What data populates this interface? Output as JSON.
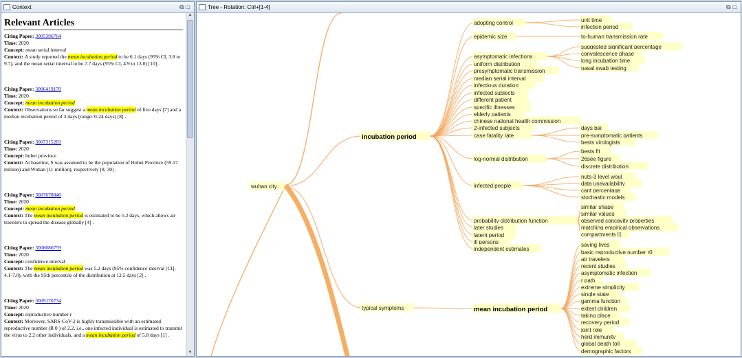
{
  "context_panel": {
    "title": "Context",
    "heading": "Relevant Articles",
    "labels": {
      "citing": "Citing Paper:",
      "time": "Time:",
      "concept": "Concept:",
      "context": "Context:"
    },
    "articles": [
      {
        "id": "3005396764",
        "time": "2020",
        "concept": "mean serial interval",
        "concept_hl": false,
        "ctx_pre": "A study reported the ",
        "ctx_hl": "mean incubation period",
        "ctx_post": " to be 6.1 days (95% CI, 3.8 to 9.7), and the mean serial interval to be 7.7 days (95% CI, 4.9 to 13.0) [10] ."
      },
      {
        "id": "3006419170",
        "time": "2020",
        "concept": "mean incubation period",
        "concept_hl": true,
        "ctx_pre": "Observations so far suggest a ",
        "ctx_hl": "mean incubation period",
        "ctx_post": " of five days [7] and a median incubation period of 3 days (range: 0-24 days) [8] ."
      },
      {
        "id": "3007315283",
        "time": "2020",
        "concept": "hubei province",
        "concept_hl": false,
        "ctx_pre": "At baseline, S was assumed to be the population of Hubei Province (59.17 million) and Wuhan (11 million), respectively [8, 30] .",
        "ctx_hl": "",
        "ctx_post": ""
      },
      {
        "id": "3007678840",
        "time": "2020",
        "concept": "mean incubation period",
        "concept_hl": true,
        "ctx_pre": "The ",
        "ctx_hl": "mean incubation period",
        "ctx_post": " is estimated to be 5.2 days, which allows air travelers to spread the disease globally [4] ."
      },
      {
        "id": "3008086759",
        "time": "2020",
        "concept": "confidence interval",
        "concept_hl": false,
        "ctx_pre": "The ",
        "ctx_hl": "mean incubation period",
        "ctx_post": " was 5.2 days (95% confidence interval [CI], 4.1-7.0), with the 95th percentile of the distribution at 12.5 days [2] ."
      },
      {
        "id": "3009170734",
        "time": "2020",
        "concept": "reproductive number r",
        "concept_hl": false,
        "ctx_pre": "Moreover, SARS-CoV-2 is highly transmissible with an estimated reproductive number (R 0 ) of 2.2, i.e., one infected individual is estimated to transmit the virus to 2.2 other individuals, and a ",
        "ctx_hl": "mean incubation period",
        "ctx_post": " of 5.8 days [1] ."
      }
    ]
  },
  "tree_panel": {
    "title": "Tree - Rotation: Ctrl+[1-4]",
    "root": "wuhan city",
    "branches": [
      {
        "label": "incubation period",
        "bold": true,
        "children": [
          {
            "label": "adopting control",
            "children": [
              "unit time",
              "infection period"
            ]
          },
          {
            "label": "epidemic size",
            "children": [
              "to-human transmission rate"
            ]
          },
          {
            "label": "asymptomatic infections",
            "children": [
              "suggested significant percentage",
              "convalescence phase",
              "long incubation time",
              "nasal swab testing"
            ]
          },
          {
            "label": "uniform distribution",
            "children": []
          },
          {
            "label": "presymptomatic transmission",
            "children": []
          },
          {
            "label": "median serial interval",
            "children": []
          },
          {
            "label": "infectious duration",
            "children": []
          },
          {
            "label": "infected subjects",
            "children": []
          },
          {
            "label": "different patient",
            "children": []
          },
          {
            "label": "specific illnesses",
            "children": []
          },
          {
            "label": "elderly patients",
            "children": []
          },
          {
            "label": "chinese national health commission",
            "children": []
          },
          {
            "label": "2-infected subjects",
            "children": []
          },
          {
            "label": "case fatality rate",
            "children": [
              "days bai",
              "pre-symptomatic patients",
              "bests virologists"
            ]
          },
          {
            "label": "log-normal distribution",
            "children": [
              "bests fit",
              "26see figure",
              "discrete distribution"
            ]
          },
          {
            "label": "infected people",
            "children": [
              "nuts-3 level woul",
              "data unavailability",
              "cant percentage",
              "stochastic models"
            ]
          },
          {
            "label": "probability distribution function",
            "children": [
              "similar shape",
              "similar values",
              "observed concavity properties",
              "matching empirical observations",
              "compartments l1"
            ]
          },
          {
            "label": "later studies",
            "children": []
          },
          {
            "label": "latent period",
            "children": []
          },
          {
            "label": "ill persons",
            "children": []
          },
          {
            "label": "independent estimates",
            "children": []
          }
        ]
      },
      {
        "label": "typical symptoms",
        "bold": false,
        "children": [
          {
            "label": "mean incubation period",
            "bold": true,
            "children": [
              "saving lives",
              "basic reproductive number r0",
              "air travelers",
              "recent studies",
              "asymptomatic infection",
              "r path",
              "extreme simplicity",
              "single state",
              "gamma function",
              "extent children",
              "taking place",
              "recovery period",
              "joint role",
              "herd immunity",
              "global death toll",
              "demographic factors"
            ]
          }
        ]
      }
    ]
  },
  "colors": {
    "highlight": "#ffff00",
    "node_bg": "#ffffc8",
    "edge": "#f6a55a",
    "edge_thick": "#f39a3c",
    "link": "#0000cc"
  },
  "icons": {
    "panel": "panel-icon",
    "restore": "restore-icon",
    "maximize": "maximize-icon"
  }
}
